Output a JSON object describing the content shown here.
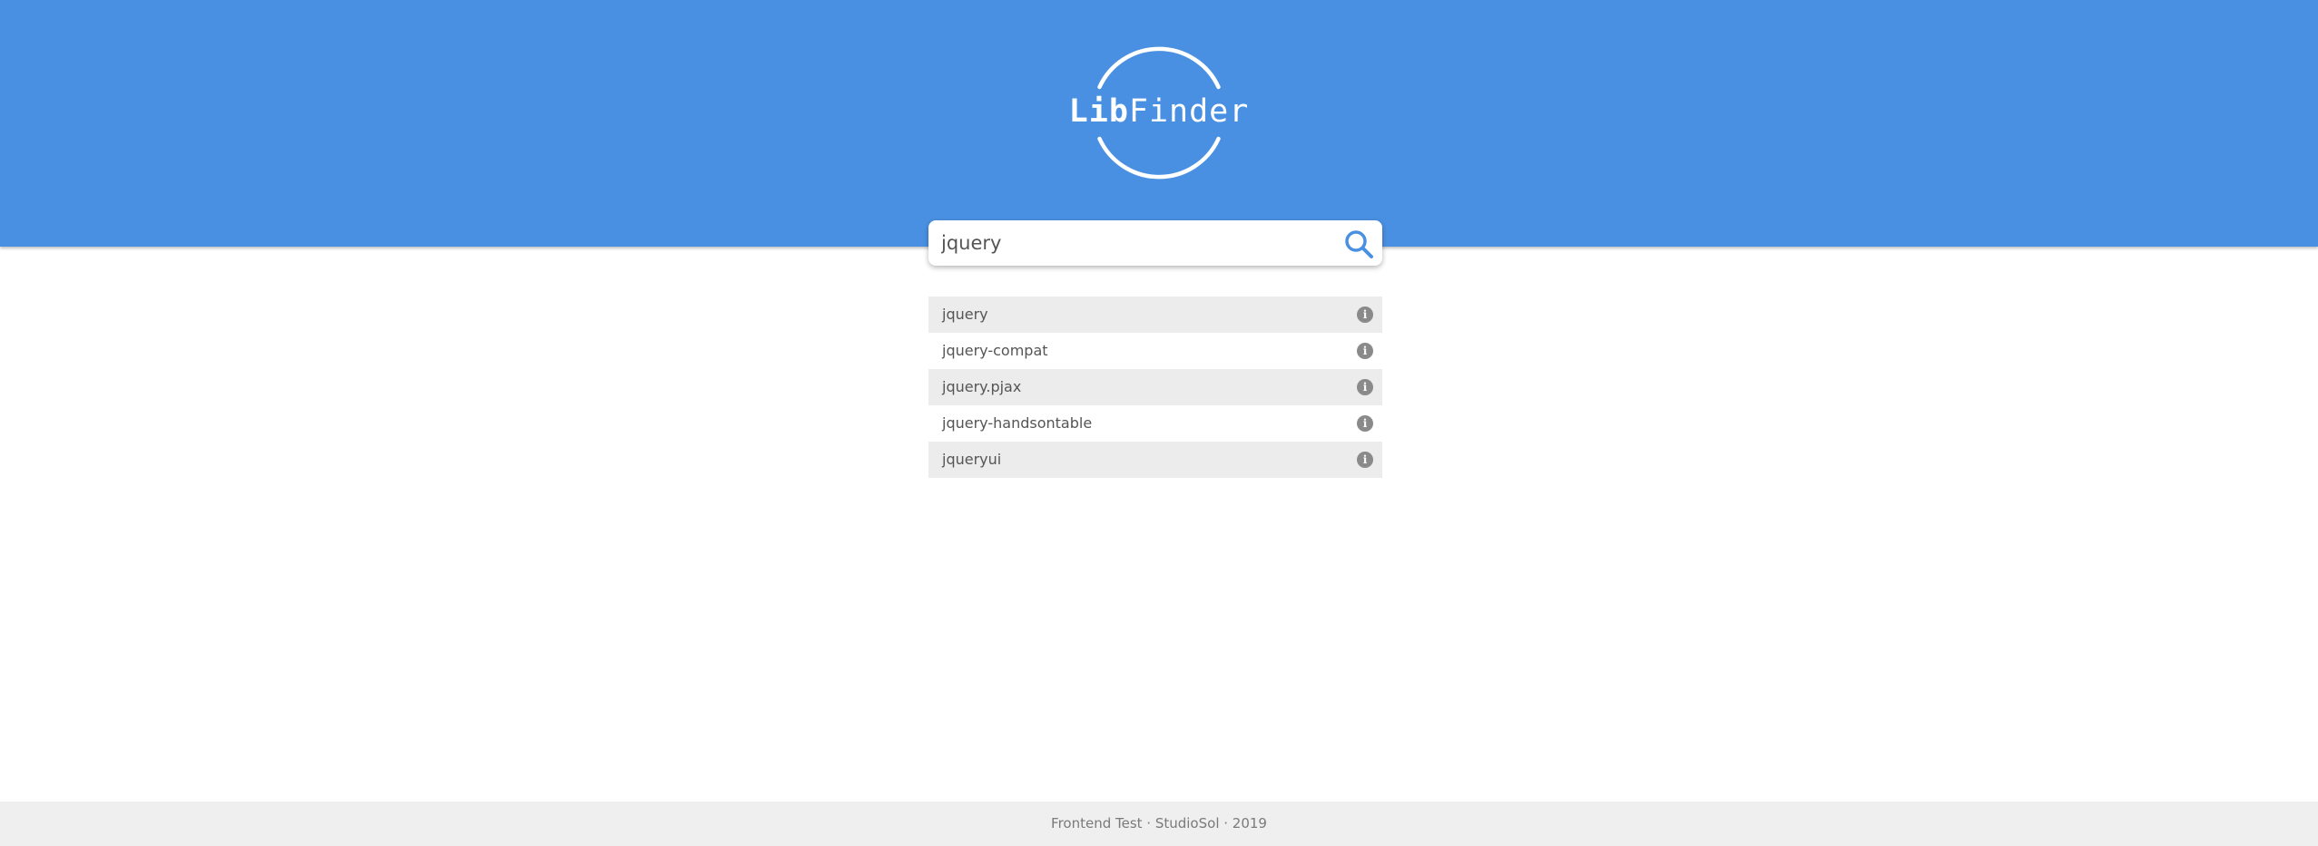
{
  "colors": {
    "header_bg": "#4a90e2",
    "accent": "#4a90e2",
    "row_alt_bg": "#ececec",
    "footer_bg": "#efefef"
  },
  "logo": {
    "bold_part": "Lib",
    "regular_part": "Finder"
  },
  "search": {
    "value": "jquery",
    "icon": "search-icon"
  },
  "results": [
    {
      "name": "jquery",
      "icon": "info-icon"
    },
    {
      "name": "jquery-compat",
      "icon": "info-icon"
    },
    {
      "name": "jquery.pjax",
      "icon": "info-icon"
    },
    {
      "name": "jquery-handsontable",
      "icon": "info-icon"
    },
    {
      "name": "jqueryui",
      "icon": "info-icon"
    }
  ],
  "footer": {
    "text": "Frontend Test · StudioSol · 2019"
  }
}
